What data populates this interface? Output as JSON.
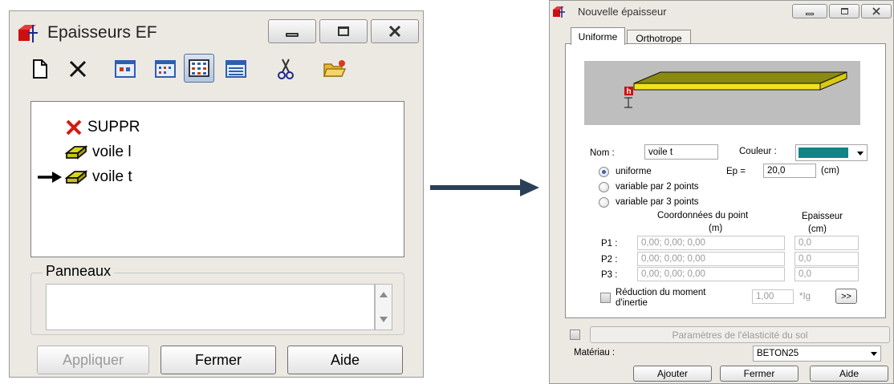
{
  "left_window": {
    "title": "Epaisseurs EF",
    "app_icon": "structure-icon",
    "caption_buttons": [
      "minimize-icon",
      "restore-icon",
      "close-icon"
    ],
    "toolbar": [
      "new-document-icon",
      "delete-x-icon",
      "view-large-icons-icon",
      "view-small-icons-icon",
      "view-list-icon",
      "view-details-icon",
      "scissors-icon",
      "open-folder-icon"
    ],
    "tree_items": [
      {
        "label": "SUPPR",
        "icon": "delete-x-icon"
      },
      {
        "label": "voile l",
        "icon": "panel-icon"
      },
      {
        "label": "voile t",
        "icon": "panel-icon",
        "current": true
      }
    ],
    "panneaux_label": "Panneaux",
    "buttons": {
      "apply": "Appliquer",
      "close": "Fermer",
      "help": "Aide"
    }
  },
  "right_window": {
    "title": "Nouvelle épaisseur",
    "app_icon": "structure-icon",
    "caption_buttons": [
      "minimize-icon",
      "restore-icon",
      "close-icon"
    ],
    "tabs": [
      "Uniforme",
      "Orthotrope"
    ],
    "active_tab": "Uniforme",
    "preview": {
      "h_label": "h",
      "slab_color": "#8a8a10",
      "slab_edge_color": "#f2e21a"
    },
    "nom_label": "Nom :",
    "nom_value": "voile t",
    "couleur_label": "Couleur :",
    "couleur_value": "#138484",
    "radios": [
      "uniforme",
      "variable par 2 points",
      "variable par 3 points"
    ],
    "selected_radio": "uniforme",
    "ep_label": "Ep =",
    "ep_value": "20,0",
    "ep_unit": "(cm)",
    "coords_header": "Coordonnées du point",
    "coords_unit": "(m)",
    "epaisseur_header": "Epaisseur",
    "epaisseur_unit": "(cm)",
    "points": [
      {
        "label": "P1 :",
        "coords": "0,00; 0,00; 0,00",
        "epaisseur": "0,0"
      },
      {
        "label": "P2 :",
        "coords": "0,00; 0,00; 0,00",
        "epaisseur": "0,0"
      },
      {
        "label": "P3 :",
        "coords": "0,00; 0,00; 0,00",
        "epaisseur": "0,0"
      }
    ],
    "reduction_label_1": "Réduction du moment",
    "reduction_label_2": "d'inertie",
    "reduction_value": "1,00",
    "reduction_unit": "*Ig",
    "more_button": ">>",
    "sol_button": "Paramètres de l'élasticité du sol",
    "materiau_label": "Matériau :",
    "materiau_value": "BETON25",
    "buttons": {
      "add": "Ajouter",
      "close": "Fermer",
      "help": "Aide"
    }
  },
  "colors": {
    "arrow": "#2b4057",
    "window_bg": "#ece9e3",
    "selection": "#3763b4"
  }
}
